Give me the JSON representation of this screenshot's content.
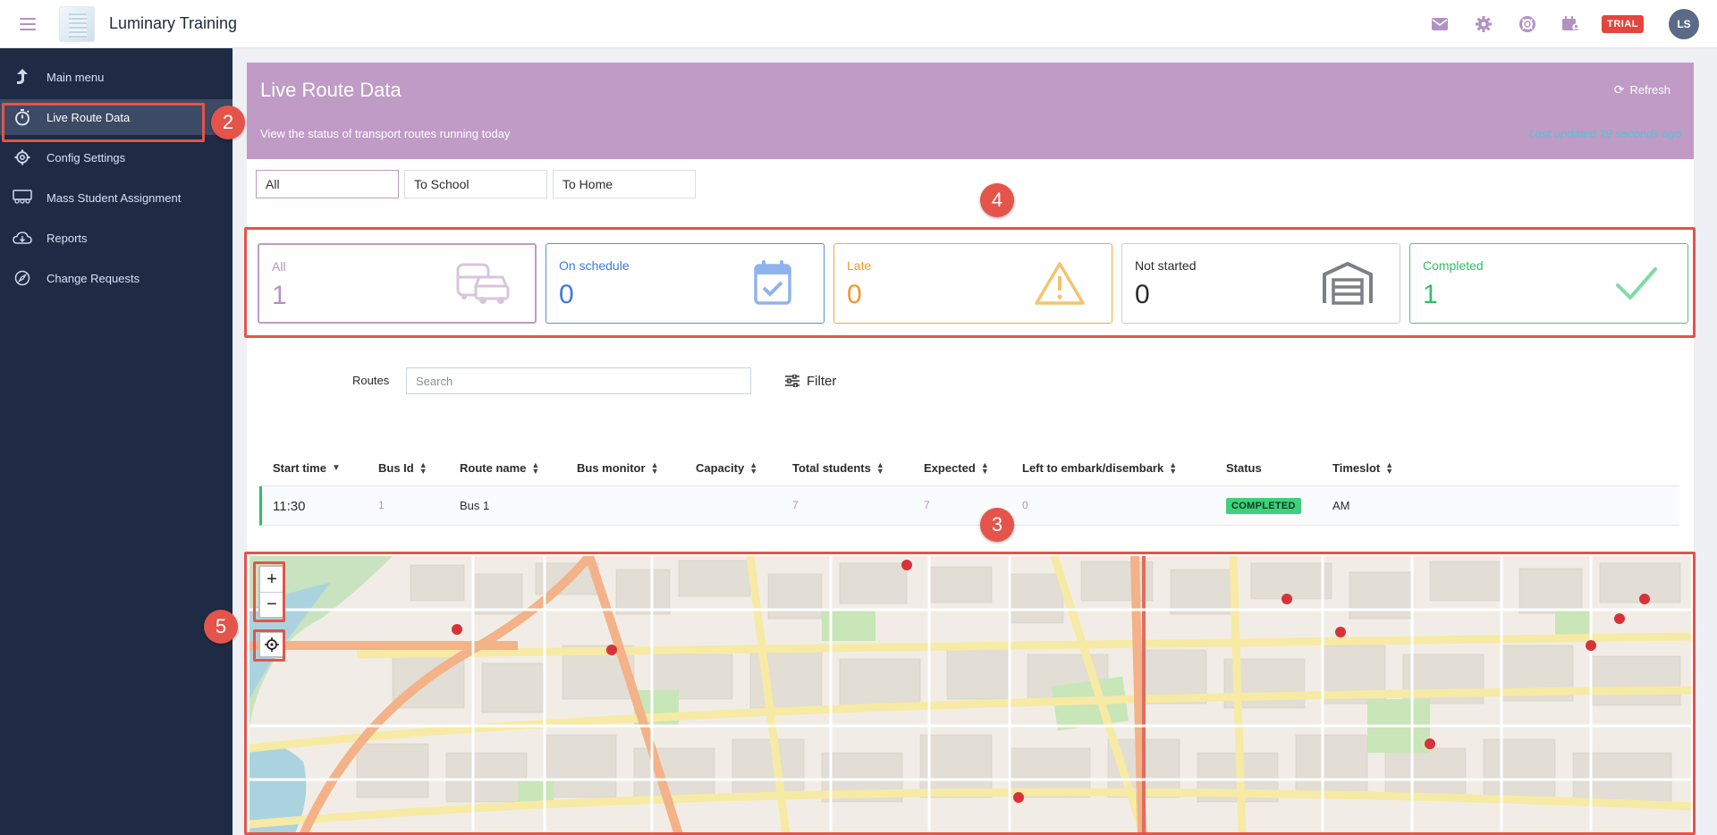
{
  "app": {
    "title": "Luminary Training",
    "trial_label": "TRIAL",
    "avatar_initials": "LS"
  },
  "sidebar": {
    "items": [
      {
        "label": "Main menu",
        "icon": "arrow-up-icon"
      },
      {
        "label": "Live Route Data",
        "icon": "stopwatch-icon",
        "active": true
      },
      {
        "label": "Config Settings",
        "icon": "gear-icon"
      },
      {
        "label": "Mass Student Assignment",
        "icon": "group-icon"
      },
      {
        "label": "Reports",
        "icon": "cloud-download-icon"
      },
      {
        "label": "Change Requests",
        "icon": "compass-icon"
      }
    ]
  },
  "header": {
    "title": "Live Route Data",
    "subtitle": "View the status of transport routes running today",
    "refresh_label": "Refresh",
    "last_updated": "Last updated 19 seconds ago"
  },
  "tabs": [
    {
      "label": "All"
    },
    {
      "label": "To School"
    },
    {
      "label": "To Home"
    }
  ],
  "cards": [
    {
      "label": "All",
      "value": "1",
      "icon": "bus-car-icon"
    },
    {
      "label": "On schedule",
      "value": "0",
      "icon": "calendar-check-icon"
    },
    {
      "label": "Late",
      "value": "0",
      "icon": "warning-icon"
    },
    {
      "label": "Not started",
      "value": "0",
      "icon": "garage-icon"
    },
    {
      "label": "Completed",
      "value": "1",
      "icon": "checkmark-icon"
    }
  ],
  "routes": {
    "label": "Routes",
    "search_placeholder": "Search",
    "filter_label": "Filter"
  },
  "table": {
    "columns": [
      "Start time",
      "Bus Id",
      "Route name",
      "Bus monitor",
      "Capacity",
      "Total students",
      "Expected",
      "Left to embark/disembark",
      "Status",
      "Timeslot"
    ],
    "rows": [
      {
        "start_time": "11:30",
        "bus_id": "1",
        "route_name": "Bus 1",
        "bus_monitor": "",
        "capacity": "",
        "total_students": "7",
        "expected": "7",
        "left": "0",
        "status": "COMPLETED",
        "timeslot": "AM"
      }
    ]
  },
  "map": {
    "zoom_in": "+",
    "zoom_out": "−"
  },
  "annotations": {
    "sidebar": "2",
    "table": "3",
    "cards": "4",
    "map_controls": "5"
  },
  "colors": {
    "accent": "#bf9bc6",
    "sidebar": "#1f2a44",
    "annotation": "#e4544a",
    "completed": "#3fd07d"
  }
}
